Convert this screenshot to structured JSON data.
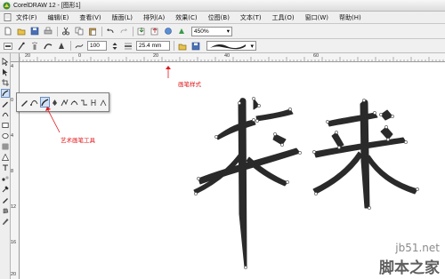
{
  "window": {
    "title": "CorelDRAW 12 - [图形1]"
  },
  "menu": [
    "文件(F)",
    "编辑(E)",
    "查看(V)",
    "版面(L)",
    "排列(A)",
    "效果(C)",
    "位图(B)",
    "文本(T)",
    "工具(O)",
    "窗口(W)",
    "帮助(H)"
  ],
  "toolbar": {
    "zoom": "450%"
  },
  "property_bar": {
    "smoothing": "100",
    "width": "25.4 mm"
  },
  "ruler": {
    "h_ticks": [
      "20",
      "0",
      "20",
      "40",
      "60"
    ],
    "v_ticks": [
      "4",
      "0",
      "4",
      "8",
      "12",
      "16",
      "20"
    ]
  },
  "annotations": {
    "pen_style": "画笔样式",
    "artistic_tool": "艺术画笔工具"
  },
  "canvas": {
    "text": "未来"
  },
  "watermark": {
    "line1": "jb51.net",
    "line2": "脚本之家"
  },
  "colors": {
    "annotation": "#e0191c",
    "glyph": "#2a2a2a",
    "highlight": "#cfe0f6"
  }
}
